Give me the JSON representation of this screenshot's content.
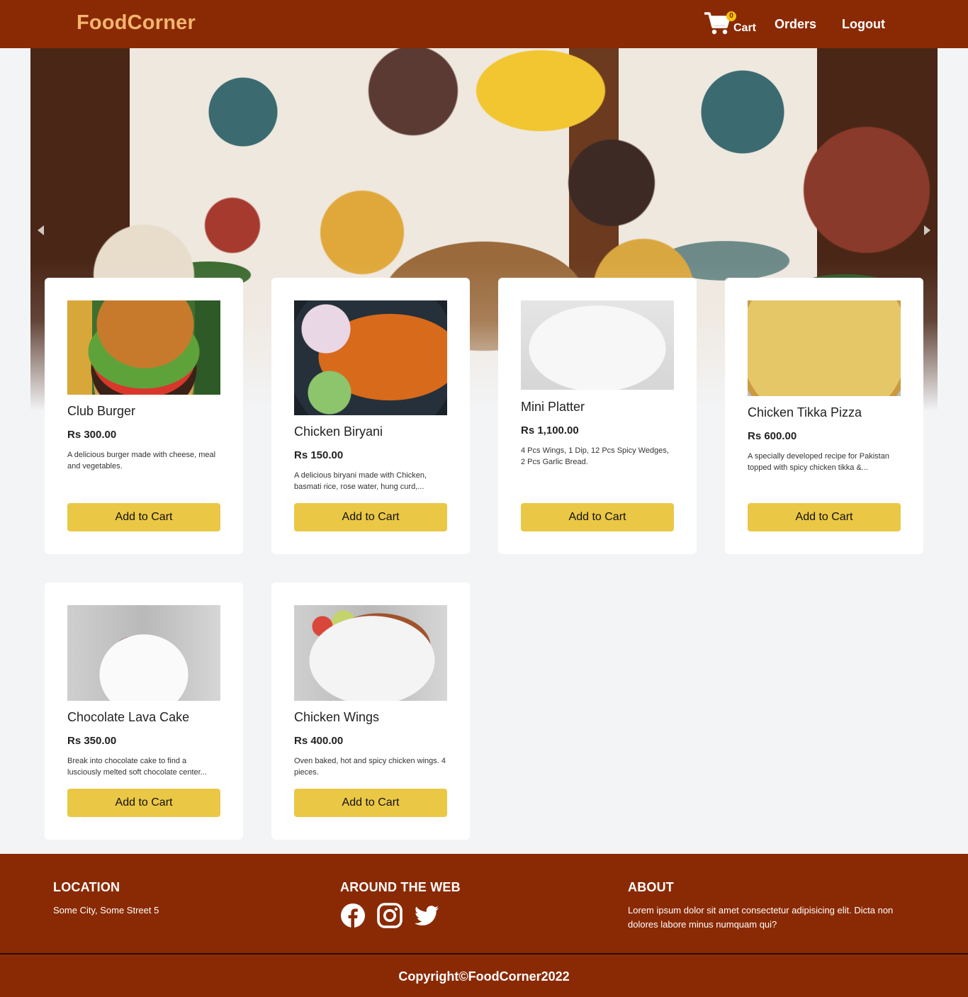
{
  "navbar": {
    "brand": "FoodCorner",
    "cart_count": "0",
    "cart_label": "Cart",
    "orders_label": "Orders",
    "logout_label": "Logout"
  },
  "products": [
    {
      "name": "Club Burger",
      "price": "Rs 300.00",
      "description": "A delicious burger made with cheese, meal and vegetables.",
      "button": "Add to Cart"
    },
    {
      "name": "Chicken Biryani",
      "price": "Rs 150.00",
      "description": "A delicious biryani made with Chicken, basmati rice, rose water, hung curd,...",
      "button": "Add to Cart"
    },
    {
      "name": "Mini Platter",
      "price": "Rs 1,100.00",
      "description": "4 Pcs Wings, 1 Dip, 12 Pcs Spicy Wedges, 2 Pcs Garlic Bread.",
      "button": "Add to Cart"
    },
    {
      "name": "Chicken Tikka Pizza",
      "price": "Rs 600.00",
      "description": "A specially developed recipe for Pakistan topped with spicy chicken tikka &...",
      "button": "Add to Cart"
    },
    {
      "name": "Chocolate Lava Cake",
      "price": "Rs 350.00",
      "description": "Break into chocolate cake to find a lusciously melted soft chocolate center...",
      "button": "Add to Cart"
    },
    {
      "name": "Chicken Wings",
      "price": "Rs 400.00",
      "description": "Oven baked, hot and spicy chicken wings. 4 pieces.",
      "button": "Add to Cart"
    }
  ],
  "footer": {
    "location_heading": "LOCATION",
    "location_text": "Some City, Some Street 5",
    "web_heading": "AROUND THE WEB",
    "social_icons": [
      "facebook-icon",
      "instagram-icon",
      "twitter-icon"
    ],
    "about_heading": "ABOUT",
    "about_text": "Lorem ipsum dolor sit amet consectetur adipisicing elit. Dicta non dolores labore minus numquam qui?",
    "copyright": "Copyright©FoodCorner2022"
  },
  "colors": {
    "nav_bg": "#8a2a04",
    "brand": "#f6b56e",
    "button": "#ebc746",
    "page_bg": "#f3f4f6"
  }
}
